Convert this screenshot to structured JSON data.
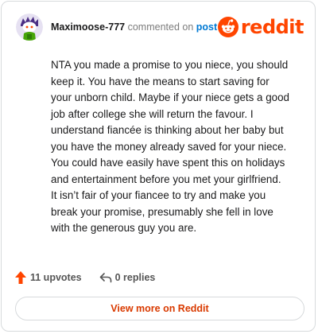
{
  "comment": {
    "username": "Maximoose-777",
    "action_text": "commented on",
    "post_link_label": "post",
    "avatar_icon": "snoo-avatar-icon",
    "body": "NTA you made a promise to you niece, you should keep it. You have the means to start saving for your unborn child. Maybe if your niece gets a good job after college she will return the favour. I understand fiancée is thinking about her baby but you have the money already saved for your niece. You could have easily have spent this on holidays and entertainment before you met your girlfriend. It isn’t fair of your fiancee to try and make you break your promise, presumably she fell in love with the generous guy you are.",
    "upvotes_label": "11 upvotes",
    "replies_label": "0 replies"
  },
  "brand": {
    "wordmark": "reddit",
    "logo_icon": "reddit-snoo-icon",
    "color": "#ff4500"
  },
  "footer": {
    "view_more_label": "View more on Reddit"
  },
  "icons": {
    "upvote": "upvote-arrow-icon",
    "reply": "reply-arrow-icon"
  },
  "colors": {
    "link": "#0079d3",
    "accent": "#d93a00",
    "upvote": "#ff4500",
    "border": "#d7dadc"
  }
}
